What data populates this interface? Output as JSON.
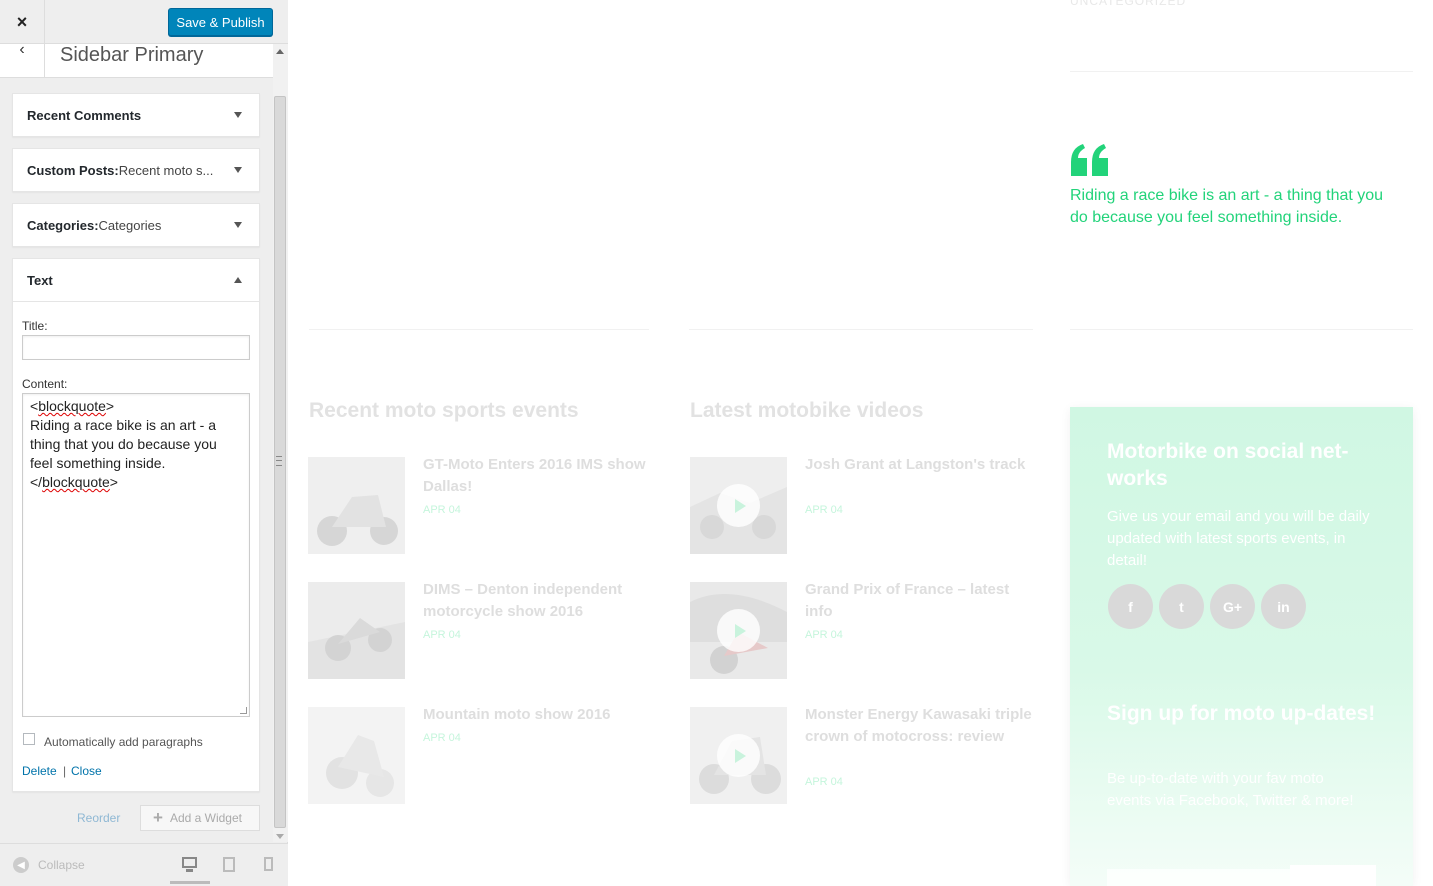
{
  "topbar": {
    "close_icon": "×",
    "publish_label": "Save & Publish"
  },
  "section": {
    "back_icon": "‹",
    "title": "Sidebar Primary"
  },
  "widgets": [
    {
      "title": "Recent Comments",
      "subtitle": ""
    },
    {
      "title": "Custom Posts:",
      "subtitle": " Recent moto s..."
    },
    {
      "title": "Categories:",
      "subtitle": " Categories"
    },
    {
      "title": "Text",
      "subtitle": ""
    }
  ],
  "text_widget": {
    "title_label": "Title:",
    "title_value": "",
    "content_label": "Content:",
    "content_lines": [
      "blockquote",
      "Riding a race bike is an art - a thing that you do because you feel something inside.",
      "blockquote"
    ],
    "auto_paragraphs_label": "Automatically add paragraphs",
    "auto_paragraphs_checked": false,
    "delete_label": "Delete",
    "separator": "|",
    "close_label": "Close"
  },
  "panel_actions": {
    "reorder_label": "Reorder",
    "add_widget_label": "Add a Widget"
  },
  "footer": {
    "collapse_label": "Collapse",
    "devices": [
      "desktop",
      "tablet",
      "mobile"
    ],
    "active_device": "desktop"
  },
  "preview": {
    "category": "UNCATEGORIZED",
    "quote": "Riding a race bike is an art - a thing that you do because you feel something inside.",
    "col1_title": "Recent moto sports events",
    "col2_title": "Latest motobike videos",
    "events": [
      {
        "title": "GT-Moto Enters 2016 IMS show Dallas!",
        "date": "APR 04"
      },
      {
        "title": "DIMS – Denton independent motorcycle show 2016",
        "date": "APR 04"
      },
      {
        "title": "Mountain moto show 2016",
        "date": "APR 04"
      }
    ],
    "videos": [
      {
        "title": "Josh Grant at Langston's track",
        "date": "APR 04"
      },
      {
        "title": "Grand Prix of France – latest info",
        "date": "APR 04"
      },
      {
        "title": "Monster Energy Kawasaki triple crown of motocross: review",
        "date": "APR 04"
      }
    ],
    "social_title": "Motorbike on social net-works",
    "social_text": "Give us your email and you will be daily updated with latest sports events, in detail!",
    "social_buttons": [
      "f",
      "t",
      "G+",
      "in"
    ],
    "signup_title": "Sign up for moto up-dates!",
    "signup_text": "Be up-to-date with your fav moto events via Facebook, Twitter & more!"
  },
  "colors": {
    "accent": "#22d37a",
    "publish": "#0085ba",
    "link": "#0073aa"
  }
}
